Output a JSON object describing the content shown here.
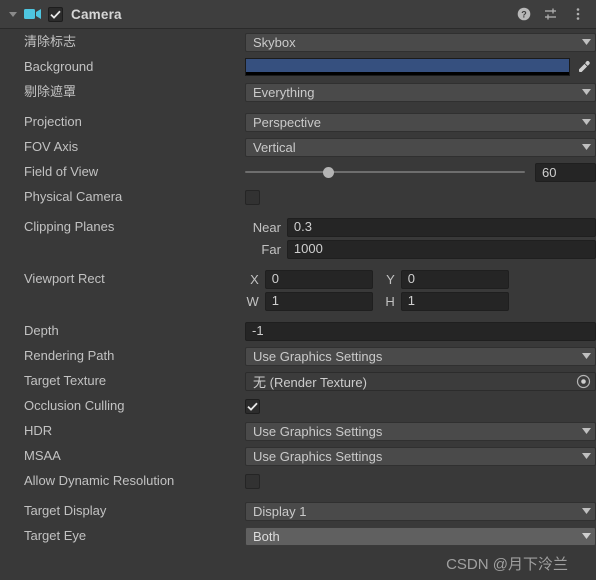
{
  "header": {
    "title": "Camera",
    "foldout_icon": "chevron-down-icon",
    "component_icon": "camera-icon",
    "enabled_checkbox": true,
    "help_icon": "help-icon",
    "preset_icon": "preset-sliders-icon",
    "menu_icon": "kebab-menu-icon"
  },
  "colors": {
    "panel_bg": "#393939",
    "header_bg": "#3e3e3e",
    "dropdown_bg": "#4a4a4a",
    "input_bg": "#252525",
    "accent_cyan": "#4ec6e0",
    "background_color_value": "#36507f",
    "text": "#c2c2c2"
  },
  "fields": {
    "clear_flags": {
      "label": "清除标志",
      "value": "Skybox"
    },
    "background": {
      "label": "Background",
      "value": "#36507f",
      "eyedropper_icon": "eyedropper-icon"
    },
    "culling_mask": {
      "label": "剔除遮罩",
      "value": "Everything"
    },
    "projection": {
      "label": "Projection",
      "value": "Perspective"
    },
    "fov_axis": {
      "label": "FOV Axis",
      "value": "Vertical"
    },
    "field_of_view": {
      "label": "Field of View",
      "value": "60",
      "slider_percent": 28
    },
    "physical_camera": {
      "label": "Physical Camera",
      "checked": false
    },
    "clipping_planes": {
      "label": "Clipping Planes",
      "near_label": "Near",
      "near_value": "0.3",
      "far_label": "Far",
      "far_value": "1000"
    },
    "viewport_rect": {
      "label": "Viewport Rect",
      "x_label": "X",
      "x_value": "0",
      "y_label": "Y",
      "y_value": "0",
      "w_label": "W",
      "w_value": "1",
      "h_label": "H",
      "h_value": "1"
    },
    "depth": {
      "label": "Depth",
      "value": "-1"
    },
    "rendering_path": {
      "label": "Rendering Path",
      "value": "Use Graphics Settings"
    },
    "target_texture": {
      "label": "Target Texture",
      "value": "无 (Render Texture)",
      "picker_icon": "object-picker-icon"
    },
    "occlusion_culling": {
      "label": "Occlusion Culling",
      "checked": true
    },
    "hdr": {
      "label": "HDR",
      "value": "Use Graphics Settings"
    },
    "msaa": {
      "label": "MSAA",
      "value": "Use Graphics Settings"
    },
    "allow_dynamic_resolution": {
      "label": "Allow Dynamic Resolution",
      "checked": false
    },
    "target_display": {
      "label": "Target Display",
      "value": "Display 1"
    },
    "target_eye": {
      "label": "Target Eye",
      "value": "Both"
    }
  },
  "watermark": "CSDN @月下泠兰"
}
